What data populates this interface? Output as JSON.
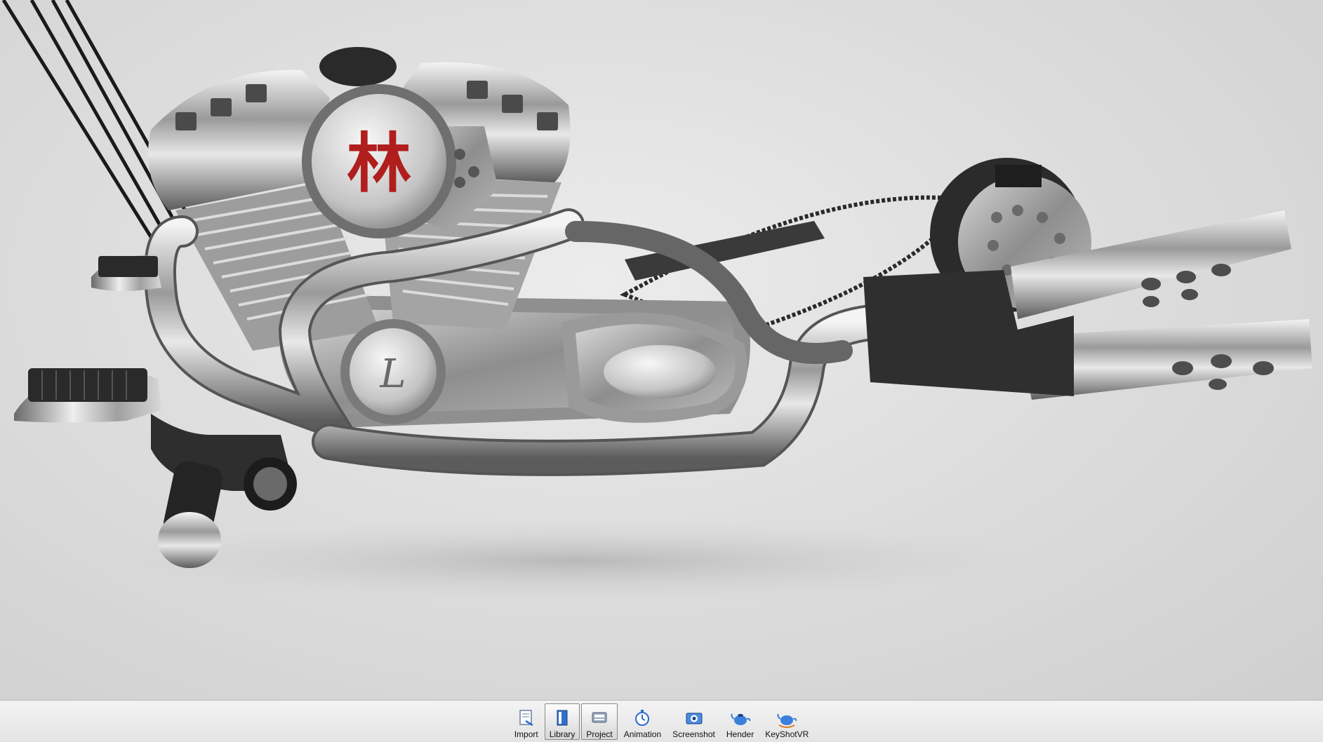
{
  "viewport": {
    "engine_emblem": "林",
    "side_cover_letter": "L"
  },
  "toolbar": {
    "buttons": [
      {
        "label": "Import",
        "icon": "import-icon",
        "active": false
      },
      {
        "label": "Library",
        "icon": "library-icon",
        "active": true
      },
      {
        "label": "Project",
        "icon": "project-icon",
        "active": true
      },
      {
        "label": "Animation",
        "icon": "animation-icon",
        "active": false
      },
      {
        "label": "Screenshot",
        "icon": "screenshot-icon",
        "active": false
      },
      {
        "label": "Hender",
        "icon": "render-teapot-icon",
        "active": false
      },
      {
        "label": "KeyShotVR",
        "icon": "keyshotvr-teapot-icon",
        "active": false
      }
    ]
  },
  "colors": {
    "background": "#dedede",
    "chrome": "#c8c8c8",
    "emblem_red": "#b01e1e",
    "toolbar": "#ececec"
  }
}
